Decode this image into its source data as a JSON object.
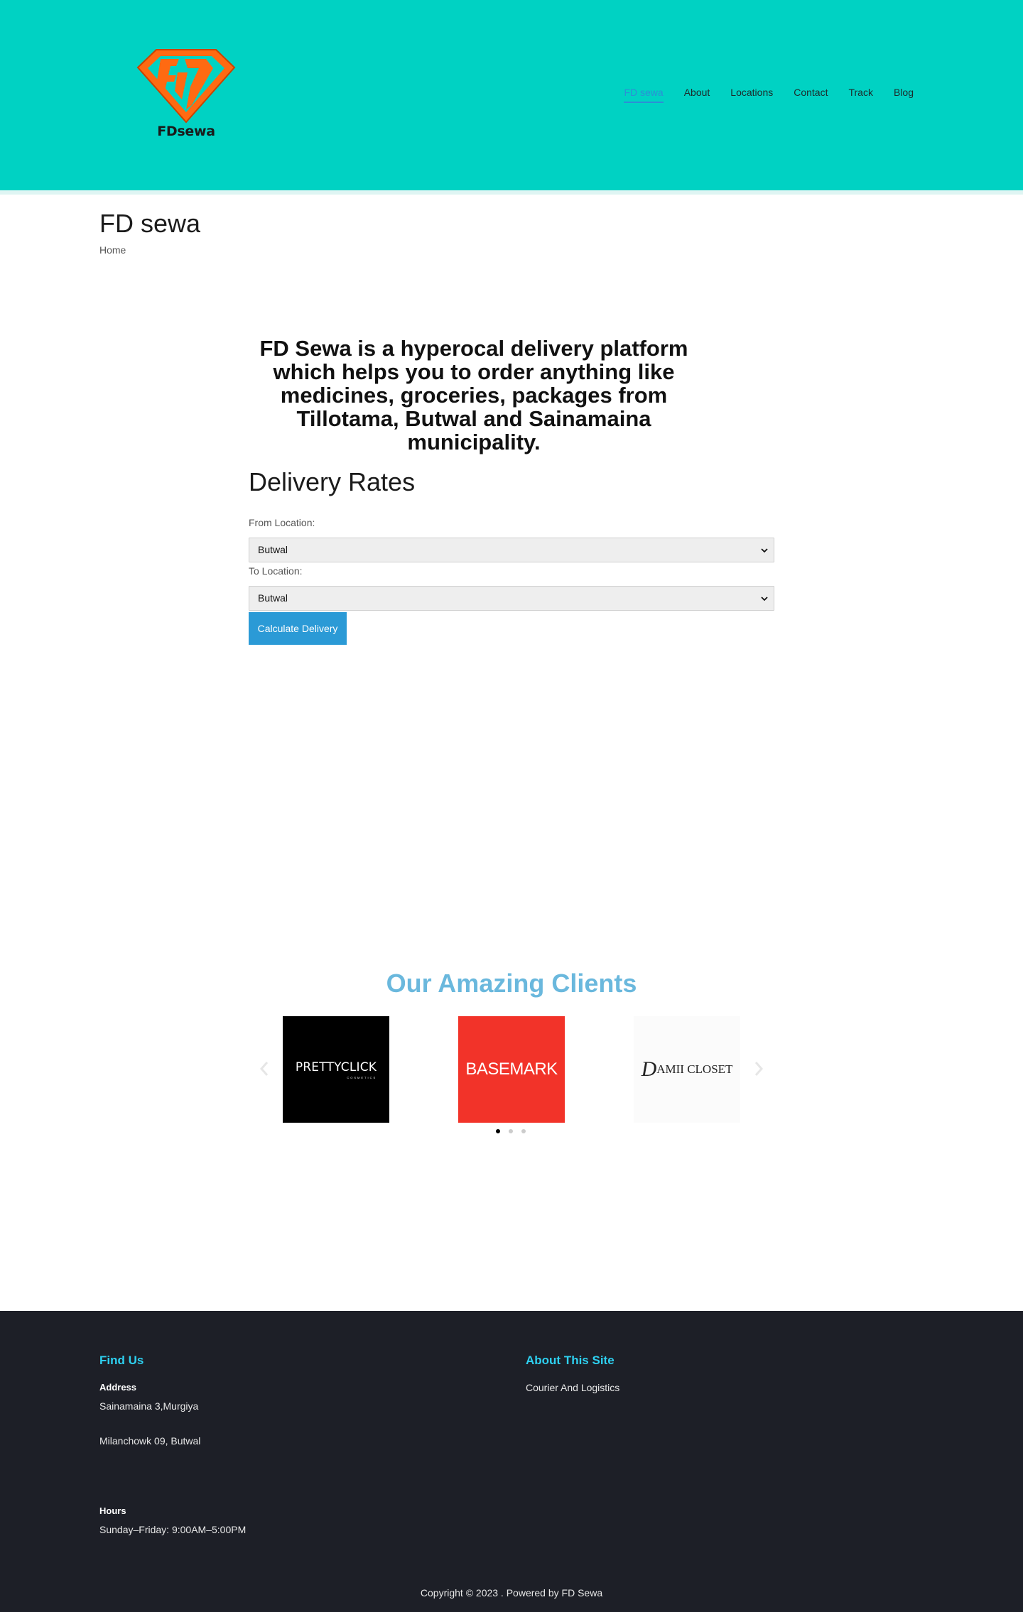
{
  "header": {
    "logo_text": "FDsewa",
    "nav": [
      {
        "label": "FD sewa",
        "active": true
      },
      {
        "label": "About"
      },
      {
        "label": "Locations"
      },
      {
        "label": "Contact"
      },
      {
        "label": "Track"
      },
      {
        "label": "Blog"
      }
    ]
  },
  "page": {
    "title": "FD sewa",
    "breadcrumb": "Home"
  },
  "intro": "FD Sewa is a hyperocal delivery platform which helps you to order anything like medicines, groceries, packages from Tillotama, Butwal and Sainamaina municipality.",
  "rates": {
    "title": "Delivery Rates",
    "from_label": "From Location:",
    "from_value": "Butwal",
    "to_label": "To Location:",
    "to_value": "Butwal",
    "button": "Calculate Delivery"
  },
  "clients": {
    "title": "Our Amazing Clients",
    "logos": [
      {
        "name": "PRETTYCLICK",
        "sub": "COSMETICS"
      },
      {
        "name": "BASEMARK"
      },
      {
        "name_initial": "D",
        "name_rest": "AMII CLOSET"
      }
    ],
    "slide_count": 3,
    "active_slide": 1
  },
  "footer": {
    "find_us": {
      "heading": "Find Us",
      "address_label": "Address",
      "address_line1": "Sainamaina 3,Murgiya",
      "address_line2": "Milanchowk 09, Butwal",
      "hours_label": "Hours",
      "hours_value": "Sunday–Friday: 9:00AM–5:00PM"
    },
    "about": {
      "heading": "About This Site",
      "text": "Courier And Logistics"
    },
    "copyright": "Copyright © 2023 . Powered by FD Sewa"
  },
  "colors": {
    "header_bg": "#00d2c3",
    "accent": "#2b9ad6",
    "clients_title": "#6ab8dd",
    "footer_bg": "#1d1f27",
    "footer_heading": "#2ed0f0",
    "logo_orange": "#ff6a12"
  }
}
